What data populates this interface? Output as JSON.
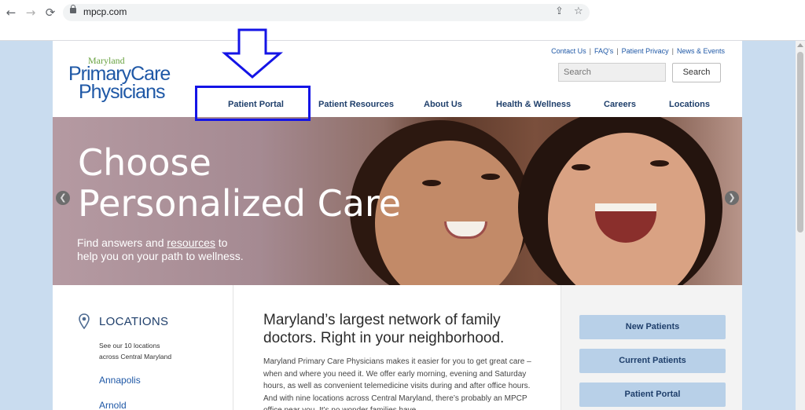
{
  "browser": {
    "url": "mpcp.com",
    "back_glyph": "←",
    "forward_glyph": "→",
    "reload_glyph": "⟳",
    "share_glyph": "⇪",
    "star_glyph": "☆"
  },
  "logo": {
    "line1": "Maryland",
    "line2": "PrimaryCare",
    "line3": "Physicians"
  },
  "utility_links": [
    "Contact Us",
    "FAQ's",
    "Patient Privacy",
    "News & Events"
  ],
  "search": {
    "placeholder": "Search",
    "button_label": "Search"
  },
  "nav": [
    "Patient Portal",
    "Patient Resources",
    "About Us",
    "Health & Wellness",
    "Careers",
    "Locations"
  ],
  "hero": {
    "title_line1": "Choose",
    "title_line2": "Personalized Care",
    "sub_prefix": "Find answers and ",
    "sub_link": "resources",
    "sub_middle": " to",
    "sub_line2": "help you on your path to wellness.",
    "prev_glyph": "❮",
    "next_glyph": "❯"
  },
  "locations": {
    "title": "LOCATIONS",
    "desc_line1": "See our 10 locations",
    "desc_line2": "across Central Maryland",
    "links": [
      "Annapolis",
      "Arnold"
    ]
  },
  "intro": {
    "title": "Maryland’s largest network of family doctors. Right in your neighborhood.",
    "body": "Maryland Primary Care Physicians makes it easier for you to get great care – when and where you need it. We offer early morning, evening and Saturday hours, as well as convenient telemedicine visits during and after office hours. And with nine locations across Central Maryland, there’s probably an MPCP office near you. It’s no wonder families have"
  },
  "side_buttons": [
    "New Patients",
    "Current Patients",
    "Patient Portal"
  ],
  "colors": {
    "brand_blue": "#1f58a6",
    "brand_green": "#6aa342",
    "annotation_blue": "#1414e6",
    "side_button_bg": "#b8d0e8"
  }
}
